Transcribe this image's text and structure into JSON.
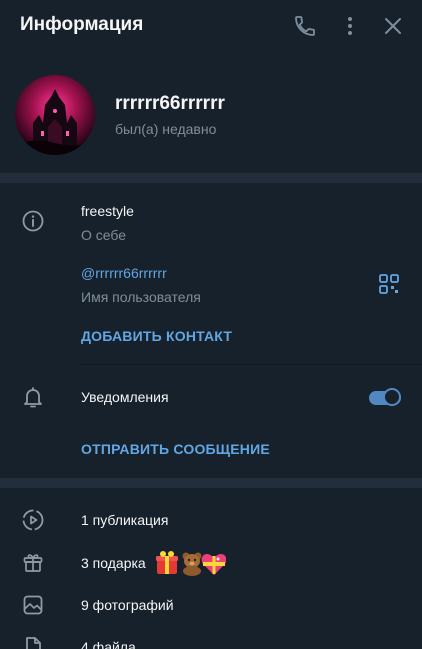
{
  "header": {
    "title": "Информация",
    "icons": [
      "phone-icon",
      "more-vertical-icon",
      "close-icon"
    ]
  },
  "profile": {
    "name": "rrrrrr66rrrrrr",
    "status": "был(а) недавно"
  },
  "info": {
    "bio": "freestyle",
    "bio_label": "О себе",
    "username": "@rrrrrr66rrrrrr",
    "username_label": "Имя пользователя",
    "add_contact": "ДОБАВИТЬ КОНТАКТ",
    "notifications_label": "Уведомления",
    "notifications_enabled": true,
    "send_message": "ОТПРАВИТЬ СООБЩЕНИЕ"
  },
  "media": {
    "publications": "1 публикация",
    "gifts": "3 подарка",
    "photos": "9 фотографий",
    "files": "4 файла"
  },
  "colors": {
    "background": "#17212b",
    "separator": "#232e3c",
    "accent": "#62a6e4",
    "secondary_text": "#7f8e9c"
  }
}
